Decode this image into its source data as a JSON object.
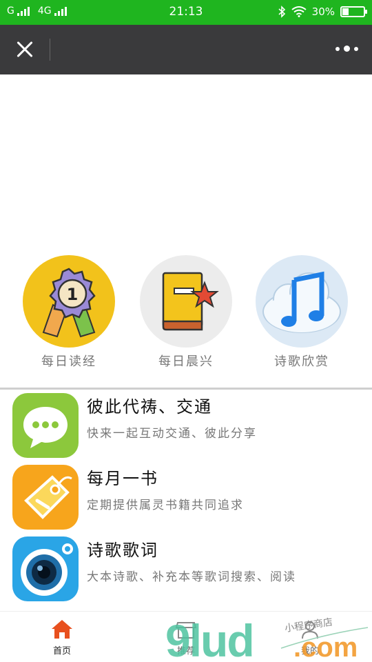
{
  "status_bar": {
    "carrier1": "G",
    "carrier2": "4G",
    "time": "21:13",
    "battery": "30%",
    "battery_level": 0.3,
    "icons": [
      "signal-icon",
      "signal-icon",
      "bluetooth-icon",
      "wifi-icon",
      "battery-icon"
    ]
  },
  "title_bar": {
    "close_icon": "close-icon",
    "more_icon": "more-dots-icon"
  },
  "categories": [
    {
      "label": "每日读经",
      "icon": "medal-icon",
      "bg": "#f2c21b"
    },
    {
      "label": "每日晨兴",
      "icon": "book-star-icon",
      "bg": "#ececec"
    },
    {
      "label": "诗歌欣赏",
      "icon": "music-cloud-icon",
      "bg": "#dce9f5"
    }
  ],
  "list": [
    {
      "title": "彼此代祷、交通",
      "subtitle": "快来一起互动交通、彼此分享",
      "icon": "chat-bubble-icon",
      "color": "#8cc83c"
    },
    {
      "title": "每月一书",
      "subtitle": "定期提供属灵书籍共同追求",
      "icon": "tag-icon",
      "color": "#f7a51c"
    },
    {
      "title": "诗歌歌词",
      "subtitle": "大本诗歌、补充本等歌词搜索、阅读",
      "icon": "camera-lens-icon",
      "color": "#2aa5e6"
    }
  ],
  "tab_bar": {
    "tabs": [
      {
        "label": "首页",
        "icon": "home-icon",
        "active": true
      },
      {
        "label": "推荐",
        "icon": "store-icon",
        "active": false
      },
      {
        "label": "我的",
        "icon": "user-icon",
        "active": false
      }
    ]
  },
  "watermark": {
    "logo": "9lud",
    "suffix": ".com",
    "caption": "小程序商店"
  },
  "colors": {
    "status_bar": "#1fb51f",
    "title_bar": "#3a3a3c",
    "home_active": "#e8501e"
  }
}
